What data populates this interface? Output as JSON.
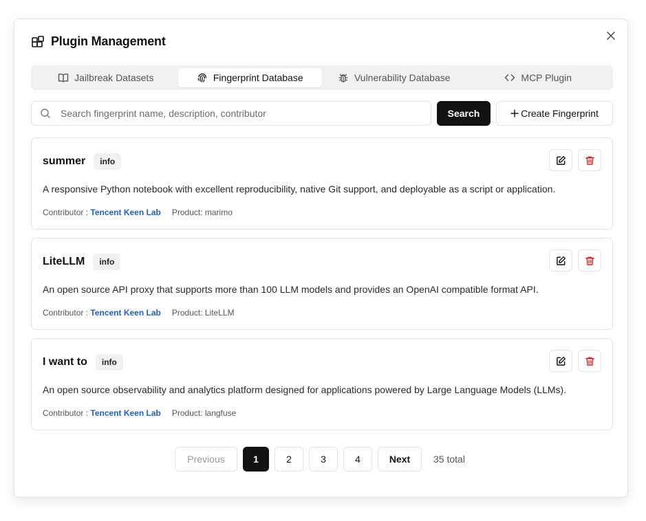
{
  "dialog": {
    "title": "Plugin Management"
  },
  "tabs": [
    {
      "label": "Jailbreak Datasets",
      "icon": "book-open-icon",
      "active": false
    },
    {
      "label": "Fingerprint Database",
      "icon": "fingerprint-icon",
      "active": true
    },
    {
      "label": "Vulnerability Database",
      "icon": "bug-icon",
      "active": false
    },
    {
      "label": "MCP Plugin",
      "icon": "code-icon",
      "active": false
    }
  ],
  "search": {
    "placeholder": "Search fingerprint name, description, contributor",
    "value": "",
    "button_label": "Search",
    "create_label": "Create Fingerprint"
  },
  "fingerprints": [
    {
      "name": "summer",
      "badge": "info",
      "description": "A responsive Python notebook with excellent reproducibility, native Git support, and deployable as a script or application.",
      "contributor_label": "Contributor :",
      "contributor": "Tencent Keen Lab",
      "product": "Product: marimo"
    },
    {
      "name": "LiteLLM",
      "badge": "info",
      "description": "An open source API proxy that supports more than 100 LLM models and provides an OpenAI compatible format API.",
      "contributor_label": "Contributor :",
      "contributor": "Tencent Keen Lab",
      "product": "Product: LiteLLM"
    },
    {
      "name": "I want to",
      "badge": "info",
      "description": "An open source observability and analytics platform designed for applications powered by Large Language Models (LLMs).",
      "contributor_label": "Contributor :",
      "contributor": "Tencent Keen Lab",
      "product": "Product: langfuse"
    }
  ],
  "pagination": {
    "previous_label": "Previous",
    "pages": [
      "1",
      "2",
      "3",
      "4"
    ],
    "current": "1",
    "next_label": "Next",
    "total_label": "35 total"
  },
  "colors": {
    "primary": "#121212",
    "link": "#1f5fcf",
    "danger": "#dc2626",
    "tab_bg": "#f1f1f3"
  }
}
